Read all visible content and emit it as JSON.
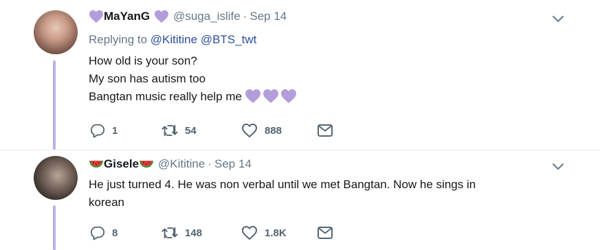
{
  "colors": {
    "thread": "#b7b2e6",
    "heart": "#b39ddb",
    "mention": "#2b4ea0",
    "muted": "#657786"
  },
  "tweets": [
    {
      "name": "MaYanG",
      "handle": "@suga_islife",
      "dot": "·",
      "date": "Sep 14",
      "replying_prefix": "Replying to",
      "reply_mentions": [
        "@Kititine",
        "@BTS_twt"
      ],
      "lines": [
        "How old is your son?",
        "My son has autism too",
        "Bangtan music really help me"
      ],
      "actions": {
        "replies": "1",
        "retweets": "54",
        "likes": "888"
      },
      "icons": [
        "purple-heart-icon",
        "reply-icon",
        "retweet-icon",
        "like-icon",
        "direct-message-icon",
        "chevron-down-icon"
      ]
    },
    {
      "name": "Gisele",
      "handle": "@Kititine",
      "dot": "·",
      "date": "Sep 14",
      "lines": [
        "He just turned 4. He was non verbal until we met Bangtan. Now he sings in",
        "korean"
      ],
      "actions": {
        "replies": "8",
        "retweets": "148",
        "likes": "1.8K"
      },
      "icons": [
        "watermelon-icon",
        "reply-icon",
        "retweet-icon",
        "like-icon",
        "direct-message-icon",
        "chevron-down-icon"
      ]
    }
  ]
}
